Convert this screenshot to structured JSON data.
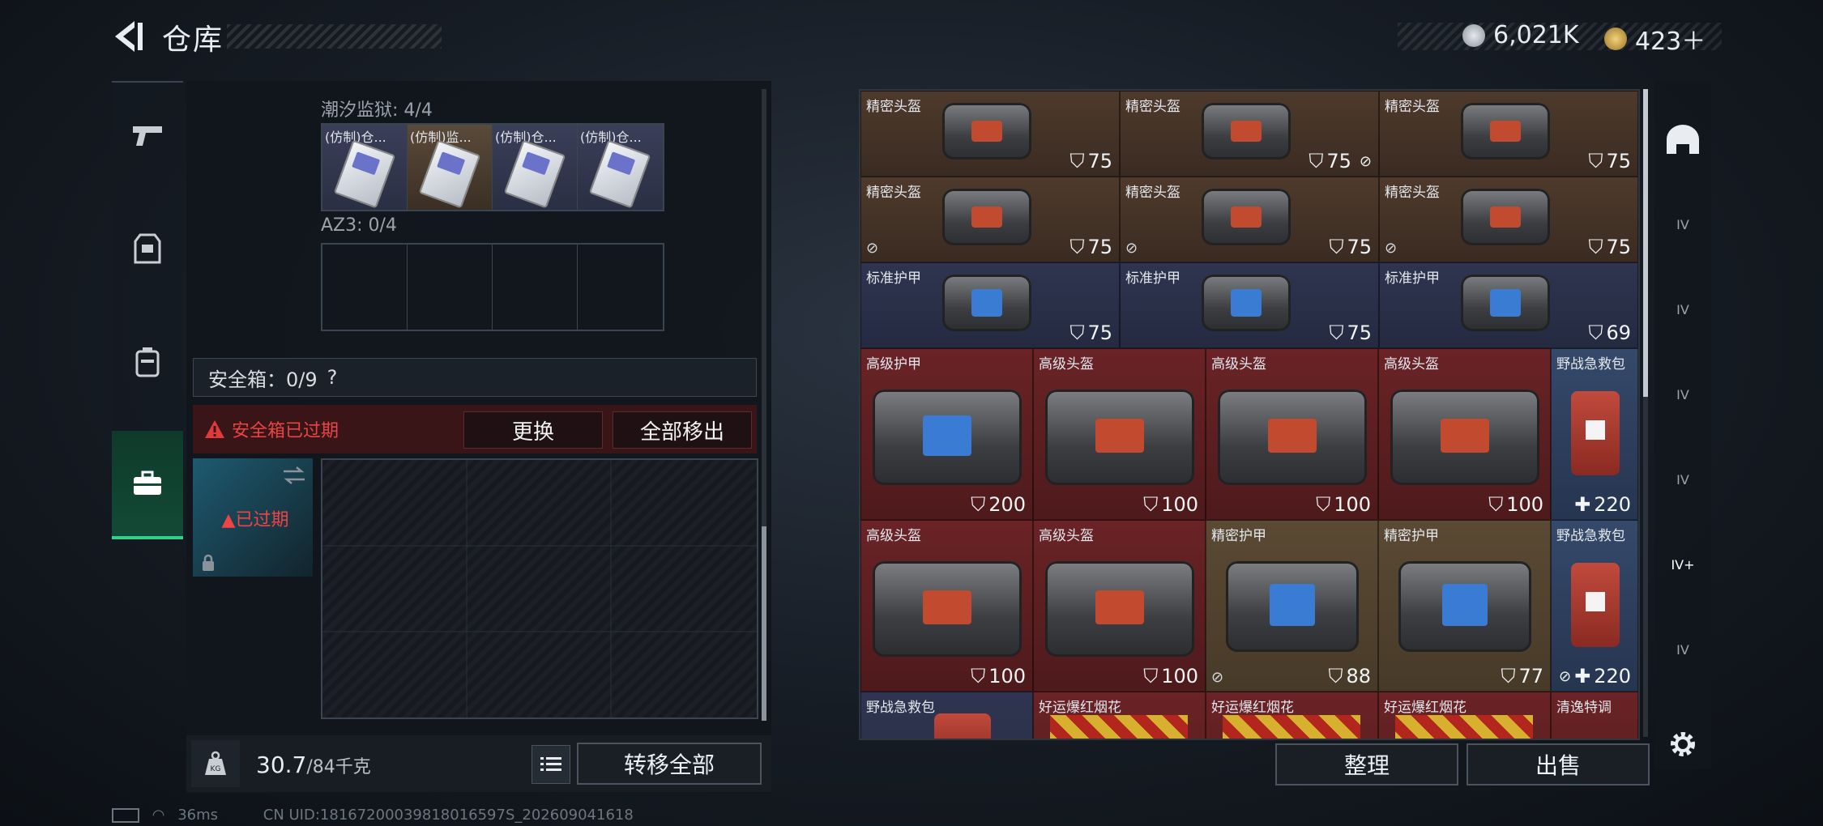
{
  "header": {
    "title": "仓库",
    "currency1": "6,021K",
    "currency2": "423＋"
  },
  "colors": {
    "accent_green": "#31d18a",
    "warning_red": "#e03a3a",
    "panel": "#11161c"
  },
  "left_nav": [
    {
      "name": "weapons",
      "icon": "pistol-icon"
    },
    {
      "name": "armor",
      "icon": "vest-icon"
    },
    {
      "name": "backpack",
      "icon": "backpack-icon"
    },
    {
      "name": "safebox",
      "icon": "toolbox-icon",
      "active": true
    }
  ],
  "storage": {
    "section1_title": "潮汐监狱: 4/4",
    "section1_items": [
      "(仿制)仓...",
      "(仿制)监...",
      "(仿制)仓...",
      "(仿制)仓..."
    ],
    "section2_title": "AZ3: 0/4",
    "safe_title": "安全箱：0/9",
    "safe_help": "?",
    "expired_warning": "安全箱已过期",
    "replace_button": "更换",
    "move_all_out_button": "全部移出",
    "safe_thumb_label": "已过期",
    "weight_current": "30.7",
    "weight_max": "/84千克",
    "weight_icon_label": "KG",
    "transfer_all_button": "转移全部"
  },
  "warehouse": {
    "row1": [
      {
        "label": "精密头盔",
        "durability": "75",
        "locked": false
      },
      {
        "label": "精密头盔",
        "durability": "75",
        "locked": true
      },
      {
        "label": "精密头盔",
        "durability": "75",
        "locked": true
      }
    ],
    "row2": [
      {
        "label": "精密头盔",
        "durability": "75"
      },
      {
        "label": "精密头盔",
        "durability": "75"
      },
      {
        "label": "精密头盔",
        "durability": "75"
      }
    ],
    "row3": [
      {
        "label": "标准护甲",
        "durability": "75"
      },
      {
        "label": "标准护甲",
        "durability": "75"
      },
      {
        "label": "标准护甲",
        "durability": "69"
      }
    ],
    "row4": [
      {
        "label": "高级护甲",
        "durability": "200"
      },
      {
        "label": "高级头盔",
        "durability": "100"
      },
      {
        "label": "高级头盔",
        "durability": "100"
      },
      {
        "label": "高级头盔",
        "durability": "100"
      },
      {
        "label": "野战急救包",
        "durability": "220"
      }
    ],
    "row5": [
      {
        "label": "高级头盔",
        "durability": "100"
      },
      {
        "label": "高级头盔",
        "durability": "100"
      },
      {
        "label": "精密护甲",
        "durability": "88"
      },
      {
        "label": "精密护甲",
        "durability": "77"
      },
      {
        "label": "野战急救包",
        "durability": "220"
      }
    ],
    "row6": [
      {
        "label": "野战急救包"
      },
      {
        "label": "好运爆红烟花"
      },
      {
        "label": "好运爆红烟花"
      },
      {
        "label": "好运爆红烟花"
      },
      {
        "label": "清逸特调"
      }
    ],
    "organize_button": "整理",
    "sell_button": "出售"
  },
  "right_nav": [
    "helmet-tab",
    "IV",
    "IV",
    "IV",
    "IV",
    "IV+",
    "IV"
  ],
  "status": {
    "ping": "36ms",
    "uid": "CN UID:18167200039818016597S_202609041618"
  }
}
